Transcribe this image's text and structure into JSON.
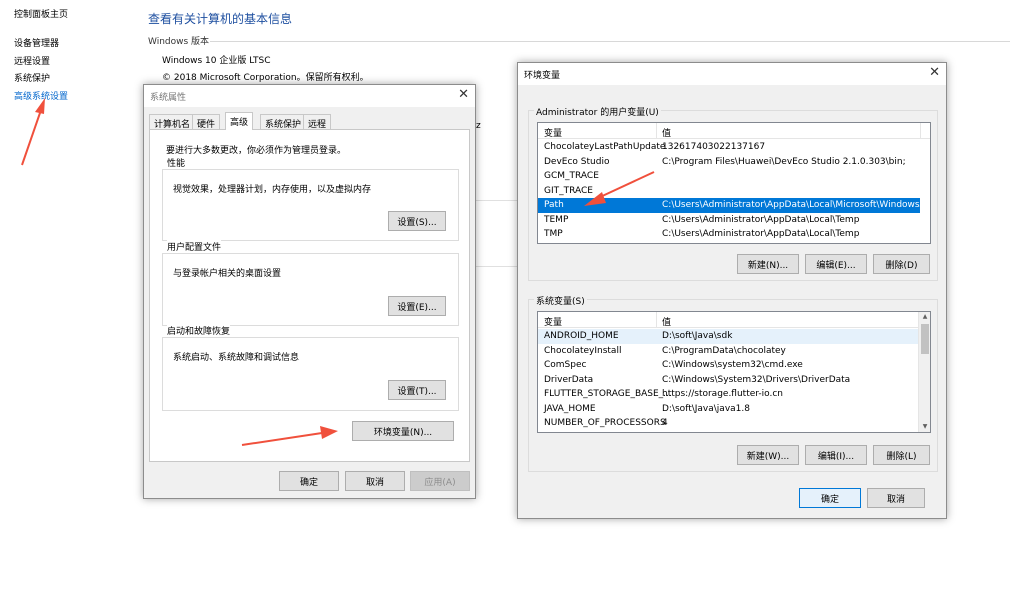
{
  "control_panel": {
    "home": "控制面板主页",
    "nav": [
      "设备管理器",
      "远程设置",
      "系统保护",
      "高级系统设置"
    ],
    "title": "查看有关计算机的基本信息",
    "section": "Windows 版本",
    "edition": "Windows 10 企业版 LTSC",
    "copyright": "© 2018 Microsoft Corporation。保留所有权利。",
    "fragment": "z"
  },
  "system_properties": {
    "title": "系统属性",
    "tabs": [
      "计算机名",
      "硬件",
      "高级",
      "系统保护",
      "远程"
    ],
    "active_tab": "高级",
    "admin_note": "要进行大多数更改，你必须作为管理员登录。",
    "performance": {
      "label": "性能",
      "desc": "视觉效果，处理器计划，内存使用，以及虚拟内存",
      "button": "设置(S)..."
    },
    "user_profiles": {
      "label": "用户配置文件",
      "desc": "与登录帐户相关的桌面设置",
      "button": "设置(E)..."
    },
    "startup_recovery": {
      "label": "启动和故障恢复",
      "desc": "系统启动、系统故障和调试信息",
      "button": "设置(T)..."
    },
    "env_button": "环境变量(N)...",
    "ok": "确定",
    "cancel": "取消",
    "apply": "应用(A)"
  },
  "env_vars": {
    "title": "环境变量",
    "user_group": "Administrator 的用户变量(U)",
    "system_group": "系统变量(S)",
    "col_var": "变量",
    "col_val": "值",
    "user_rows": [
      {
        "name": "ChocolateyLastPathUpdate",
        "value": "132617403022137167"
      },
      {
        "name": "DevEco Studio",
        "value": "C:\\Program Files\\Huawei\\DevEco Studio 2.1.0.303\\bin;"
      },
      {
        "name": "GCM_TRACE",
        "value": ""
      },
      {
        "name": "GIT_TRACE",
        "value": ""
      },
      {
        "name": "Path",
        "value": "C:\\Users\\Administrator\\AppData\\Local\\Microsoft\\WindowsA..."
      },
      {
        "name": "TEMP",
        "value": "C:\\Users\\Administrator\\AppData\\Local\\Temp"
      },
      {
        "name": "TMP",
        "value": "C:\\Users\\Administrator\\AppData\\Local\\Temp"
      }
    ],
    "selected_user_row": "Path",
    "system_rows": [
      {
        "name": "ANDROID_HOME",
        "value": "D:\\soft\\Java\\sdk"
      },
      {
        "name": "ChocolateyInstall",
        "value": "C:\\ProgramData\\chocolatey"
      },
      {
        "name": "ComSpec",
        "value": "C:\\Windows\\system32\\cmd.exe"
      },
      {
        "name": "DriverData",
        "value": "C:\\Windows\\System32\\Drivers\\DriverData"
      },
      {
        "name": "FLUTTER_STORAGE_BASE_...",
        "value": "https://storage.flutter-io.cn"
      },
      {
        "name": "JAVA_HOME",
        "value": "D:\\soft\\Java\\java1.8"
      },
      {
        "name": "NUMBER_OF_PROCESSORS",
        "value": "4"
      }
    ],
    "user_buttons": [
      "新建(N)...",
      "编辑(E)...",
      "删除(D)"
    ],
    "system_buttons": [
      "新建(W)...",
      "编辑(I)...",
      "删除(L)"
    ],
    "ok": "确定",
    "cancel": "取消"
  },
  "colors": {
    "accent": "#0078d7",
    "link": "#0066cc",
    "title": "#1e4fa0",
    "arrow": "#f0503c"
  }
}
